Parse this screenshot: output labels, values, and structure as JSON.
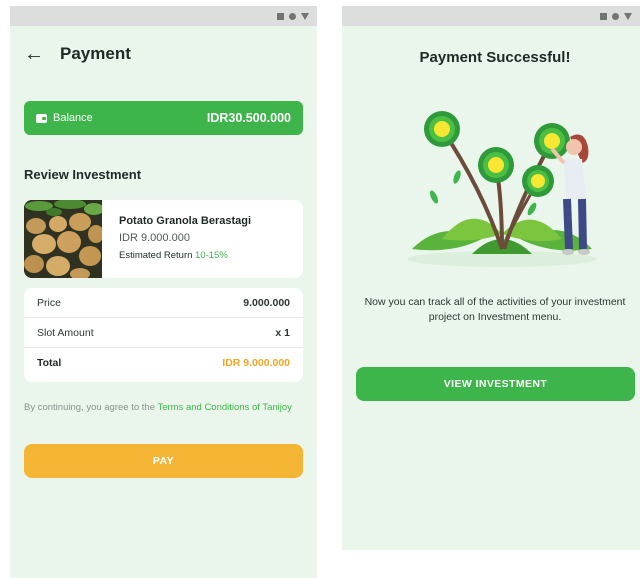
{
  "colors": {
    "brand_green": "#3db54a",
    "accent_orange": "#f4b534",
    "total_orange": "#f2a623",
    "screen_background": "#eaf6ec"
  },
  "statusbar": {
    "icons": [
      "square-icon",
      "circle-icon",
      "triangle-icon"
    ]
  },
  "payment_screen": {
    "back_icon": "arrow-left-icon",
    "title": "Payment",
    "balance": {
      "icon": "wallet-icon",
      "label": "Balance",
      "value": "IDR30.500.000"
    },
    "section_title": "Review Investment",
    "product": {
      "name": "Potato Granola Berastagi",
      "price": "IDR 9.000.000",
      "return_label": "Estimated Return",
      "return_range": "10-15%"
    },
    "summary": {
      "price_label": "Price",
      "price_value": "9.000.000",
      "slot_label": "Slot Amount",
      "slot_value": "x 1",
      "total_label": "Total",
      "total_value": "IDR 9.000.000"
    },
    "terms": {
      "prefix": "By continuing, you agree to the ",
      "link": "Terms and Conditions of Tanijoy"
    },
    "pay_button": "PAY"
  },
  "success_screen": {
    "title": "Payment Successful!",
    "message": "Now you can track all of the activities of your investment project on Investment menu.",
    "view_button": "VIEW INVESTMENT"
  }
}
